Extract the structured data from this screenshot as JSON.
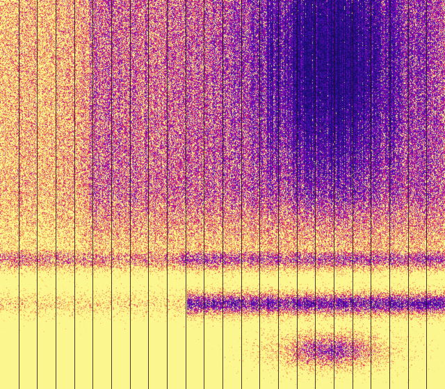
{
  "colors": {
    "background": "#fbf68e",
    "divider": "#1a0a10",
    "palette": [
      "#1b0c6e",
      "#3b10a8",
      "#7a0cc0",
      "#b0169c",
      "#d8266c",
      "#ef5a4a",
      "#f7a04a",
      "#fbe07a",
      "#fbf68e"
    ]
  },
  "heatmap": {
    "column_count": 24,
    "description_type": "spectrogram-like noise heatmap"
  }
}
